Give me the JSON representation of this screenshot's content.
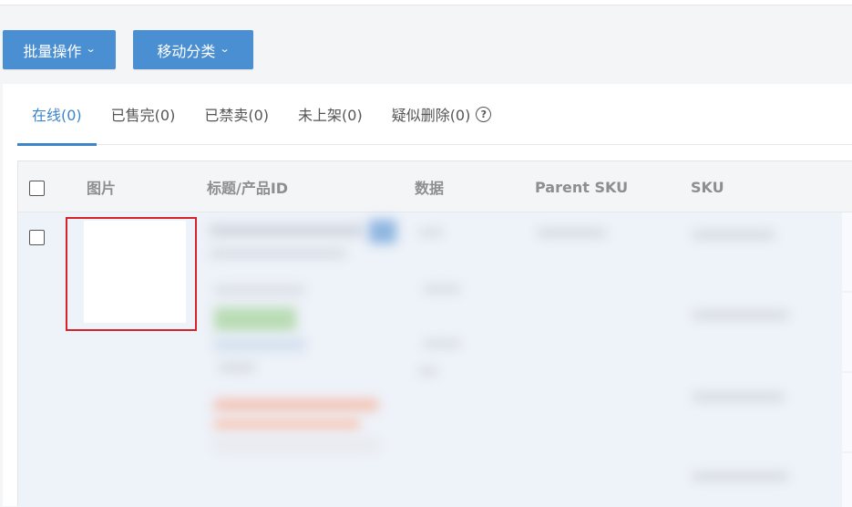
{
  "toolbar": {
    "batch_label": "批量操作",
    "move_label": "移动分类"
  },
  "tabs": [
    {
      "label": "在线(0)",
      "active": true
    },
    {
      "label": "已售完(0)",
      "active": false
    },
    {
      "label": "已禁卖(0)",
      "active": false
    },
    {
      "label": "未上架(0)",
      "active": false
    },
    {
      "label": "疑似删除(0)",
      "active": false
    }
  ],
  "table": {
    "columns": [
      "图片",
      "标题/产品ID",
      "数据",
      "Parent SKU",
      "SKU"
    ]
  },
  "icons": {
    "dropdown": "chevron-down-icon",
    "help": "question-circle-icon"
  },
  "colors": {
    "primary_button": "#4a8fd2",
    "active_tab": "#3d84c9",
    "highlight_box": "#d8222b",
    "row_background": "#eef2f9"
  }
}
